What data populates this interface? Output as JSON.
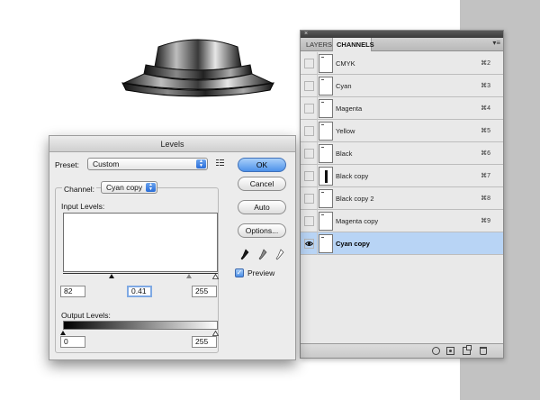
{
  "canvas": {
    "background": "#ffffff",
    "strip_color": "#c2c2c2"
  },
  "panel": {
    "tabs": [
      {
        "label": "LAYERS",
        "active": false
      },
      {
        "label": "CHANNELS",
        "active": true
      }
    ],
    "menu_icon": "panel-menu-icon",
    "channels": [
      {
        "name": "CMYK",
        "shortcut": "⌘2",
        "visible": false,
        "selected": false,
        "thumb": "white"
      },
      {
        "name": "Cyan",
        "shortcut": "⌘3",
        "visible": false,
        "selected": false,
        "thumb": "white"
      },
      {
        "name": "Magenta",
        "shortcut": "⌘4",
        "visible": false,
        "selected": false,
        "thumb": "white"
      },
      {
        "name": "Yellow",
        "shortcut": "⌘5",
        "visible": false,
        "selected": false,
        "thumb": "white"
      },
      {
        "name": "Black",
        "shortcut": "⌘6",
        "visible": false,
        "selected": false,
        "thumb": "white"
      },
      {
        "name": "Black copy",
        "shortcut": "⌘7",
        "visible": false,
        "selected": false,
        "thumb": "bar"
      },
      {
        "name": "Black copy 2",
        "shortcut": "⌘8",
        "visible": false,
        "selected": false,
        "thumb": "white"
      },
      {
        "name": "Magenta copy",
        "shortcut": "⌘9",
        "visible": false,
        "selected": false,
        "thumb": "white"
      },
      {
        "name": "Cyan copy",
        "shortcut": "",
        "visible": true,
        "selected": true,
        "thumb": "white"
      }
    ],
    "selected_color": "#b8d4f5",
    "bottom_icons": [
      "load-selection-icon",
      "save-selection-icon",
      "new-channel-icon",
      "trash-icon"
    ]
  },
  "levels": {
    "title": "Levels",
    "preset_label": "Preset:",
    "preset_value": "Custom",
    "channel_label": "Channel:",
    "channel_value": "Cyan copy",
    "input_levels_label": "Input Levels:",
    "input_black": "82",
    "input_gamma": "0.41",
    "input_white": "255",
    "output_levels_label": "Output Levels:",
    "output_black": "0",
    "output_white": "255",
    "buttons": {
      "ok": "OK",
      "cancel": "Cancel",
      "auto": "Auto",
      "options": "Options..."
    },
    "preview_label": "Preview",
    "preview_checked": true,
    "eyedroppers": [
      "black-eyedropper-icon",
      "gray-eyedropper-icon",
      "white-eyedropper-icon"
    ],
    "accent_color": "#4d92ea"
  }
}
